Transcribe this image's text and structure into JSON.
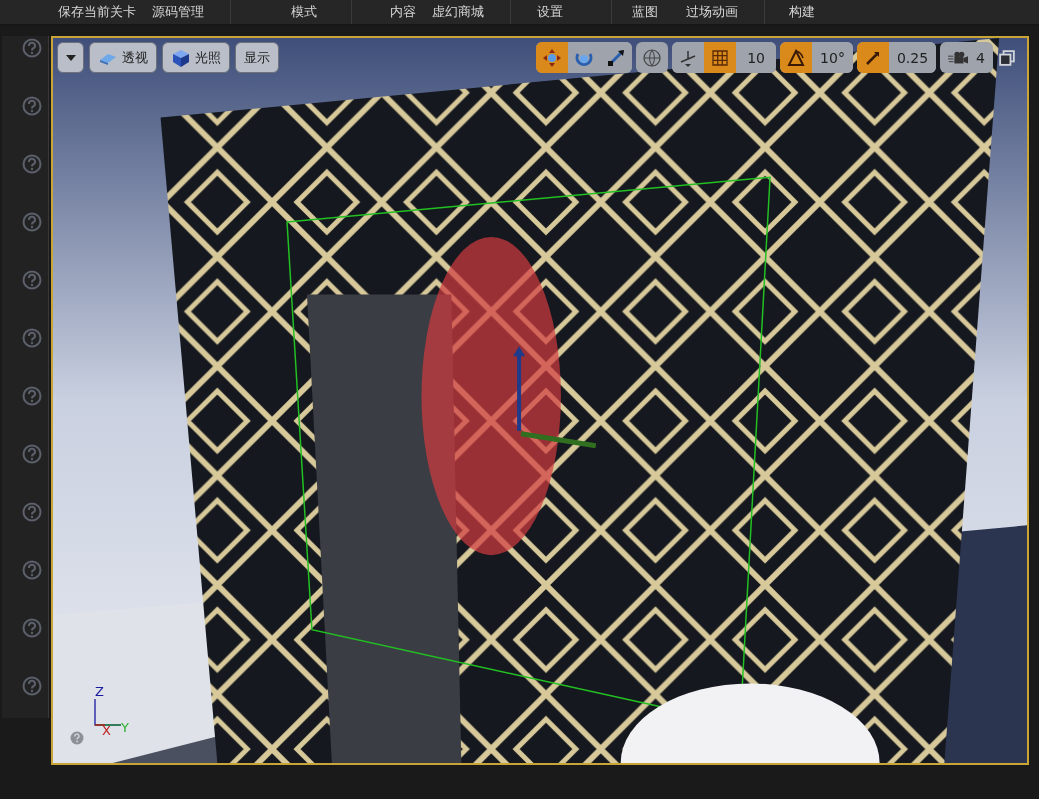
{
  "menu_bar": {
    "items": [
      {
        "label": "保存当前关卡"
      },
      {
        "label": "源码管理"
      },
      {
        "label": "模式"
      },
      {
        "label": "内容"
      },
      {
        "label": "虚幻商城"
      },
      {
        "label": "设置"
      },
      {
        "label": "蓝图"
      },
      {
        "label": "过场动画"
      },
      {
        "label": "构建"
      }
    ]
  },
  "viewport": {
    "left_buttons": [
      {
        "kind": "menu"
      },
      {
        "kind": "view",
        "label": "透视"
      },
      {
        "kind": "lighting",
        "label": "光照"
      },
      {
        "kind": "show",
        "label": "显示"
      }
    ],
    "transform_tools": [
      {
        "kind": "move",
        "selected": true
      },
      {
        "kind": "rotate",
        "selected": false
      },
      {
        "kind": "scale",
        "selected": false
      }
    ],
    "snaps": [
      {
        "kind": "grid",
        "on": true,
        "value": "10"
      },
      {
        "kind": "rotation",
        "on": true,
        "value": "10°"
      },
      {
        "kind": "scale",
        "on": true,
        "value": "0.25"
      }
    ],
    "camera_speed": "4",
    "axes": [
      {
        "kind": "z",
        "label": "Z"
      },
      {
        "kind": "x",
        "label": "X"
      },
      {
        "kind": "y",
        "label": "Y"
      }
    ]
  }
}
